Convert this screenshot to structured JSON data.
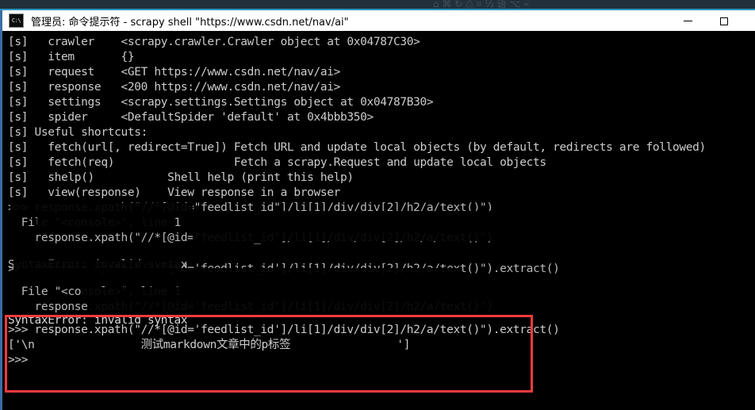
{
  "background": {
    "strip_text": "⌂  ⌘  ↻   ⎙   ⌗  ⅓ 语  ⌥ ⌁",
    "accent_color": "#2c98c4"
  },
  "window": {
    "title": "管理员: 命令提示符 - scrapy  shell \"https://www.csdn.net/nav/ai\"",
    "icon_label": "C:\\",
    "controls": {
      "minimize": "−",
      "maximize": "□",
      "close": "×"
    },
    "border_color": "#3a6ea5"
  },
  "console": {
    "background_color": "#000000",
    "text_color": "#cccccc",
    "lines": [
      {
        "text": "[s]   crawler    <scrapy.crawler.Crawler object at 0x04787C30>"
      },
      {
        "text": "[s]   item       {}"
      },
      {
        "text": "[s]   request    <GET https://www.csdn.net/nav/ai>"
      },
      {
        "text": "[s]   response   <200 https://www.csdn.net/nav/ai>"
      },
      {
        "text": "[s]   settings   <scrapy.settings.Settings object at 0x04787B30>"
      },
      {
        "text": "[s]   spider     <DefaultSpider 'default' at 0x4bbb350>"
      },
      {
        "text": "[s] Useful shortcuts:"
      },
      {
        "text": "[s]   fetch(url[, redirect=True]) Fetch URL and update local objects (by default, redirects are followed)"
      },
      {
        "text": "[s]   fetch(req)                  Fetch a scrapy.Request and update local objects"
      },
      {
        "text": "[s]   shelp()           Shell help (print this help)"
      },
      {
        "text": "[s]   view(response)    View response in a browser"
      }
    ],
    "torn_lines": [
      {
        "text": ">>> response.xpath(\"//*[@id=\"feedlist_id\"]/li[1]/div/div[2]/h2/a/text()\")"
      },
      {
        "text": "  File \"<console>\", line 1"
      },
      {
        "text": "    response.xpath(\"//*[@id=\"feedlist_id\"]/li[1]/div/div[2]/h2/a/text()\")"
      },
      {
        "text": "SyntaxError: invalid syntax"
      },
      {
        "text": ">>> response.xpath(\"//*[@id='feedlist_id']/li[1]/div/div[2]/h2/a/text()\").extract()"
      },
      {
        "text": "  File \"<console>\", line 1"
      },
      {
        "text": "    response.xpath(\"//*[@id='feedlist_id']/li[1]/div/div[2]/h2/a/text()\")"
      }
    ],
    "error_line": "SyntaxError: invalid syntax",
    "highlighted": {
      "prompt_line": ">>> response.xpath(\"//*[@id='feedlist_id']/li[1]/div/div[2]/h2/a/text()\").extract()",
      "result_line_prefix": "['\\n                ",
      "result_text": "测试markdown文章中的p标签",
      "result_line_suffix": "                ']",
      "trailing_prompt": ">>>",
      "box_color": "#f23b3b"
    }
  }
}
